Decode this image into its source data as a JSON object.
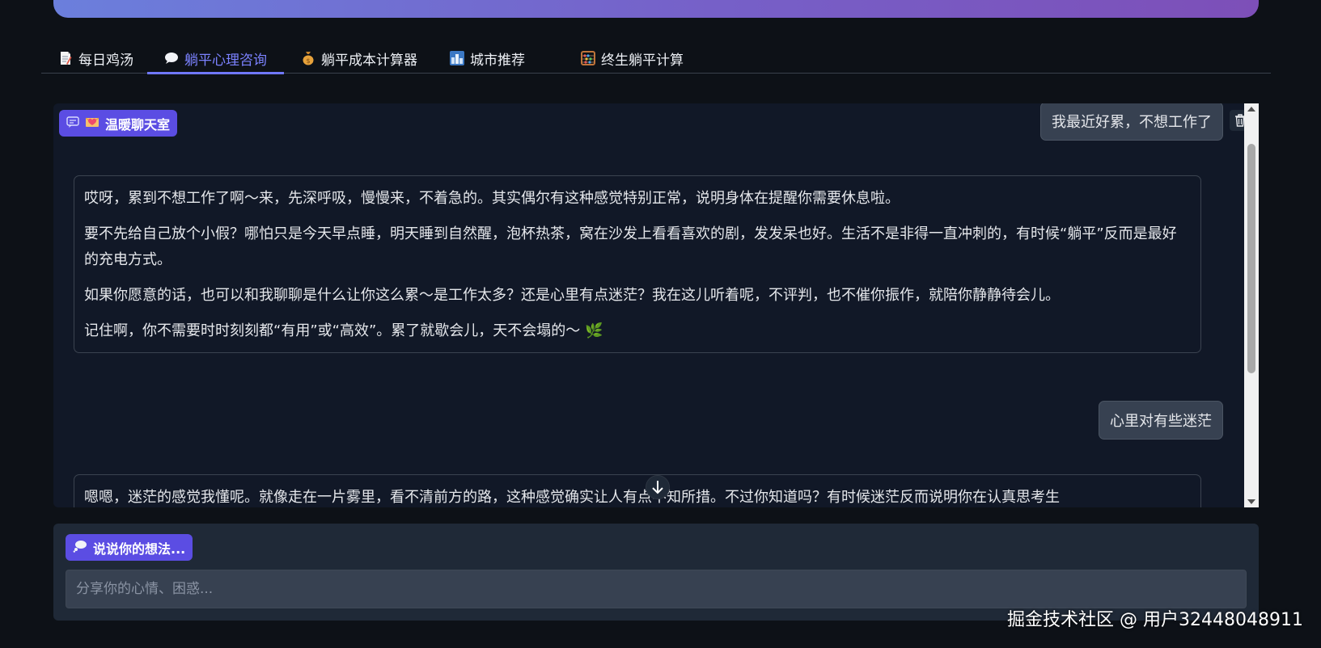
{
  "tabs": [
    {
      "label": "每日鸡汤",
      "icon": "memo-icon"
    },
    {
      "label": "躺平心理咨询",
      "icon": "speech-bubble-icon",
      "active": true
    },
    {
      "label": "躺平成本计算器",
      "icon": "money-bag-icon"
    },
    {
      "label": "城市推荐",
      "icon": "city-icon"
    },
    {
      "label": "终生躺平计算",
      "icon": "abacus-icon"
    }
  ],
  "chat": {
    "label": "温暖聊天室",
    "messages": [
      {
        "role": "user",
        "text": "我最近好累，不想工作了"
      },
      {
        "role": "bot",
        "paragraphs": [
          "哎呀，累到不想工作了啊～来，先深呼吸，慢慢来，不着急的。其实偶尔有这种感觉特别正常，说明身体在提醒你需要休息啦。",
          "要不先给自己放个小假？哪怕只是今天早点睡，明天睡到自然醒，泡杯热茶，窝在沙发上看看喜欢的剧，发发呆也好。生活不是非得一直冲刺的，有时候“躺平”反而是最好的充电方式。",
          "如果你愿意的话，也可以和我聊聊是什么让你这么累～是工作太多？还是心里有点迷茫？我在这儿听着呢，不评判，也不催你振作，就陪你静静待会儿。",
          "记住啊，你不需要时时刻刻都“有用”或“高效”。累了就歇会儿，天不会塌的～ 🌿"
        ]
      },
      {
        "role": "user",
        "text": "心里对有些迷茫"
      },
      {
        "role": "bot",
        "paragraphs": [
          "嗯嗯，迷茫的感觉我懂呢。就像走在一片雾里，看不清前方的路，这种感觉确实让人有点不知所措。不过你知道吗？有时候迷茫反而说明你在认真思考生"
        ]
      }
    ]
  },
  "input": {
    "label": "说说你的想法...",
    "placeholder": "分享你的心情、困惑..."
  },
  "watermark": "掘金技术社区 @ 用户32448048911",
  "colors": {
    "accent": "#7078ff",
    "label_bg": "#5b4de3",
    "panel_bg": "#111827",
    "input_bg": "#1f2937"
  }
}
